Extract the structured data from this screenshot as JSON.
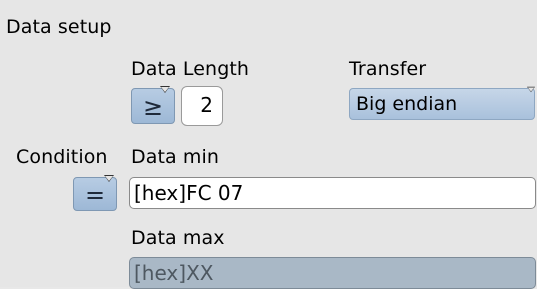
{
  "section_title": "Data setup",
  "data_length": {
    "label": "Data Length",
    "operator_symbol": "≥",
    "value": "2"
  },
  "transfer": {
    "label": "Transfer",
    "selected": "Big endian"
  },
  "condition": {
    "label": "Condition",
    "operator_symbol": "="
  },
  "data_min": {
    "label": "Data min",
    "value": "[hex]FC 07"
  },
  "data_max": {
    "label": "Data max",
    "value": "[hex]XX"
  }
}
